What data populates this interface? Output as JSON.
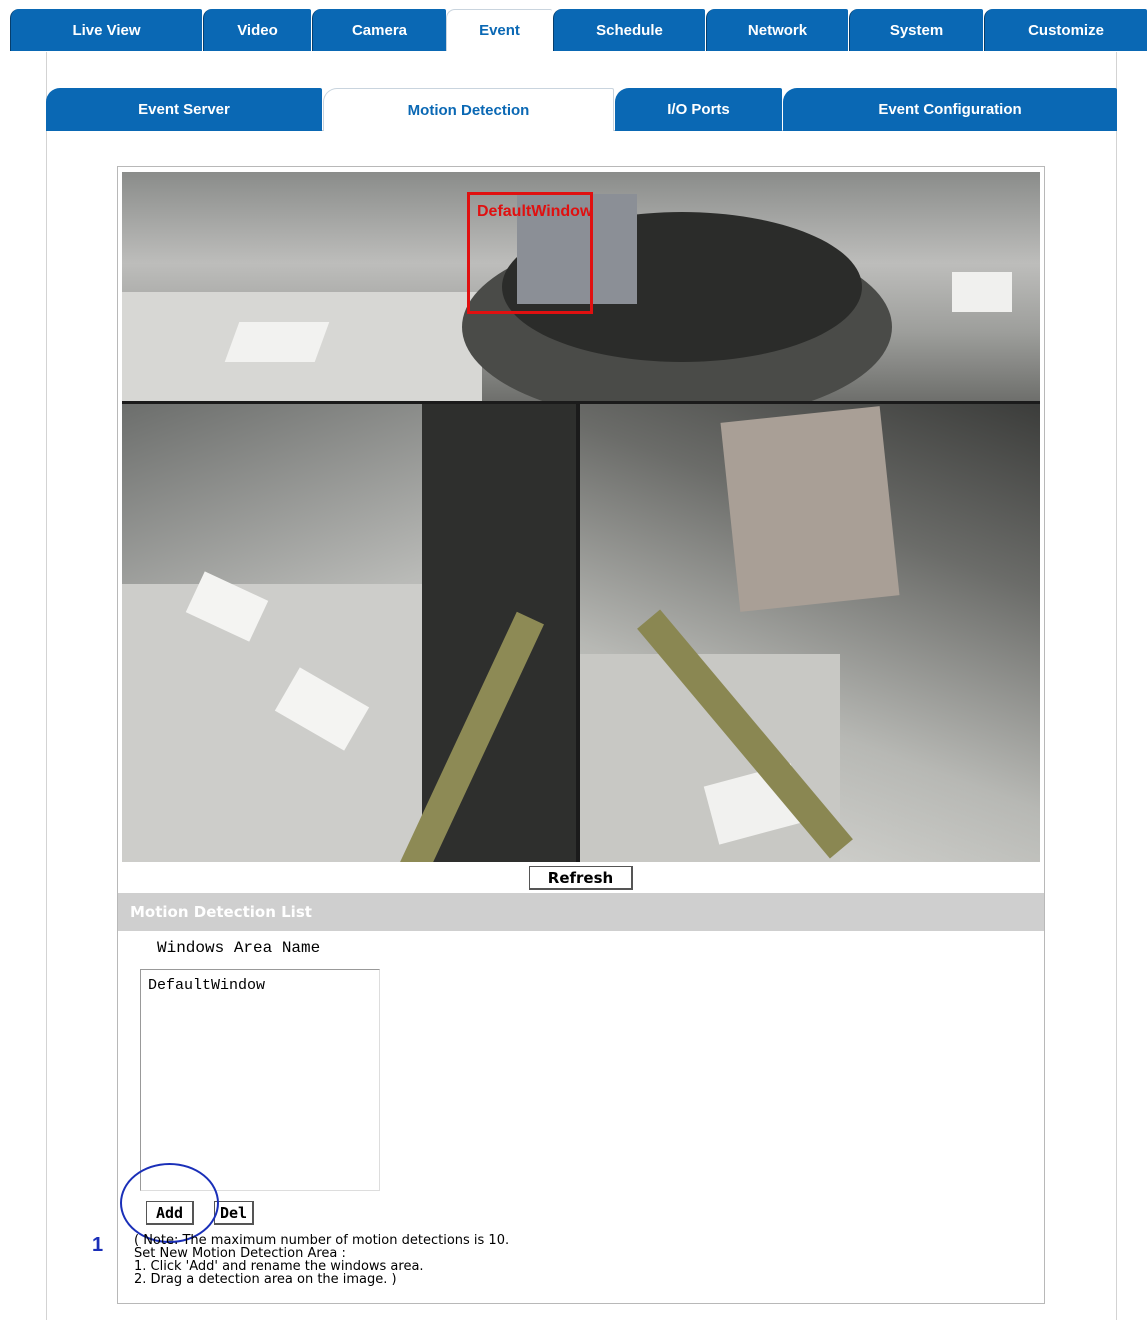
{
  "top_tabs": {
    "items": [
      "Live View",
      "Video",
      "Camera",
      "Event",
      "Schedule",
      "Network",
      "System",
      "Customize"
    ],
    "active": "Event"
  },
  "sub_tabs": {
    "items": [
      "Event Server",
      "Motion Detection",
      "I/O Ports",
      "Event Configuration"
    ],
    "active": "Motion Detection"
  },
  "camera": {
    "overlay_label": "DefaultWindow"
  },
  "refresh_label": "Refresh",
  "motion_list": {
    "header": "Motion Detection List",
    "column_label": "Windows Area Name",
    "items": [
      "DefaultWindow"
    ],
    "add_label": "Add",
    "del_label": "Del"
  },
  "annotation": {
    "step": "1",
    "ring_color": "#1a2fb8"
  },
  "notes": [
    "( Note: The maximum number of motion detections is 10.",
    "Set New Motion Detection Area :",
    "1. Click 'Add' and rename the windows area.",
    "2. Drag a detection area on the image. )"
  ],
  "colors": {
    "tab_blue": "#0a68b4",
    "motion_window": "#e01010",
    "list_header_bg": "#cfcfcf"
  }
}
